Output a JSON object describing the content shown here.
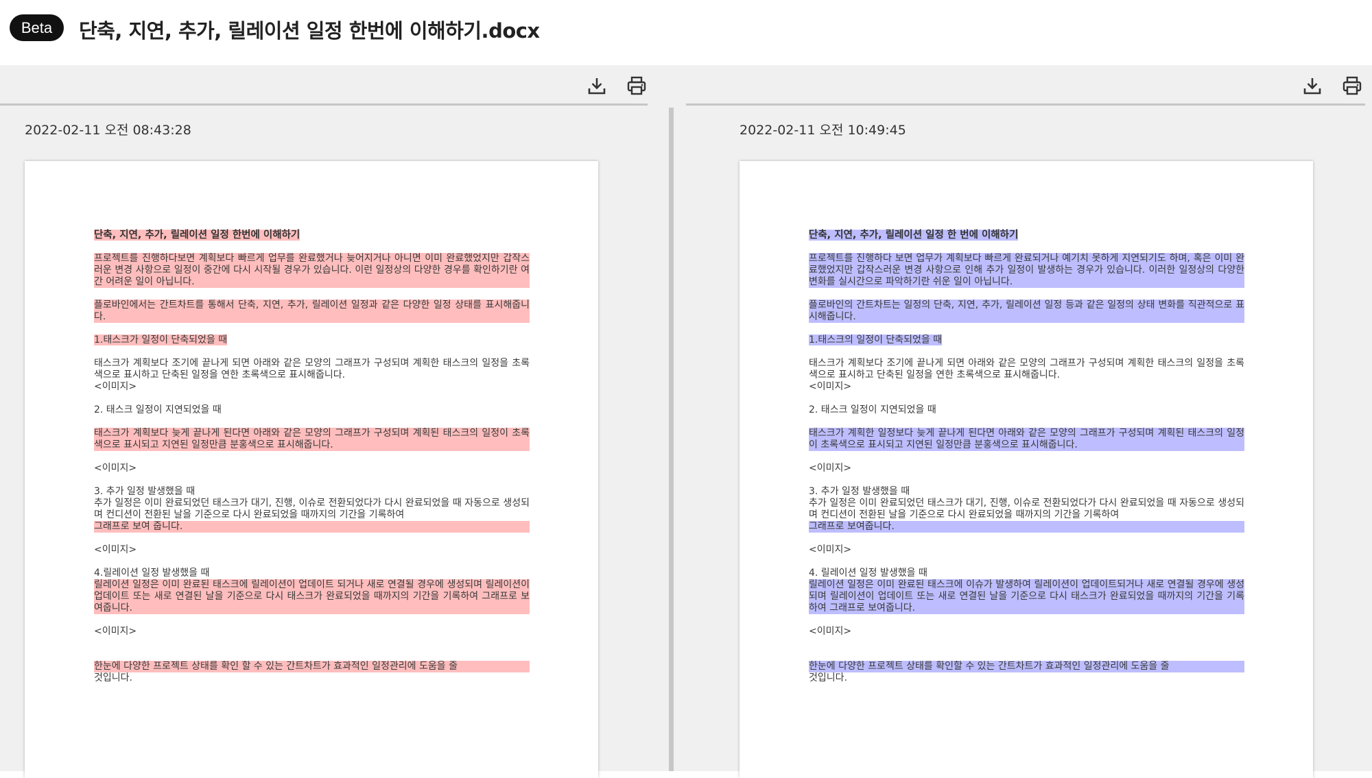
{
  "header": {
    "badge": "Beta",
    "title": "단축, 지연, 추가, 릴레이션 일정 한번에 이해하기.docx"
  },
  "colors": {
    "deleted_highlight": "#ffbdbd",
    "inserted_highlight": "#bdbdff",
    "badge_background": "#111111"
  },
  "toolbar_icons": {
    "download": "download-icon",
    "print": "print-icon"
  },
  "left": {
    "timestamp": "2022-02-11 오전 08:43:28",
    "title": "단축, 지연, 추가, 릴레이션 일정 한번에 이해하기",
    "p1": "프로젝트를 진행하다보면 계획보다 빠르게 업무를 완료했거나 늦어지거나 아니면 이미 완료했었지만 갑작스러운 변경 사항으로 일정이 중간에 다시 시작될 경우가 있습니다. 이런 일정상의 다양한 경우를 확인하기란 여간 어려운 일이 아닙니다.",
    "p2": "플로바인에서는 간트차트를 통해서 단축, 지연, 추가, 릴레이션 일정과 같은 다양한 일정 상태를 표시해줍니다.",
    "s1": "1.태스크가 일정이 단축되었을 때",
    "s1_body": "태스크가 계획보다 조기에 끝나게 되면 아래와 같은 모양의 그래프가 구성되며 계획한 태스크의 일정을 초록색으로 표시하고 단축된 일정을 연한 초록색으로 표시해줍니다.",
    "img1": "<이미지>",
    "s2": "2. 태스크 일정이 지연되었을 때",
    "s2_body": "태스크가 계획보다 늦게 끝나게 된다면 아래와 같은 모양의 그래프가 구성되며 계획된 태스크의 일정이 초록색으로 표시되고 지연된 일정만큼 분홍색으로 표시해줍니다.",
    "img2": "<이미지>",
    "s3": "3. 추가 일정 발생했을 때",
    "s3_body": "추가 일정은 이미 완료되었던 태스크가 대기, 진행, 이슈로 전환되었다가 다시 완료되었을 때 자동으로 생성되며 컨디션이 전환된 날을 기준으로 다시 완료되었을 때까지의 기간을 기록하여",
    "s3_tail": "그래프로 보여 줍니다.",
    "img3": "<이미지>",
    "s4": "4.릴레이션 일정 발생했을 때",
    "s4_body": "릴레이션 일정은 이미 완료된 태스크에 릴레이션이 업데이트 되거나 새로 연결될 경우에 생성되며 릴레이션이 업데이트 또는 새로 연결된 날을 기준으로 다시 태스크가 완료되었을 때까지의 기간을 기록하여 그래프로 보여줍니다.",
    "img4": "<이미지>",
    "closing": "한눈에 다양한 프로젝트 상태를 확인 할 수 있는 간트차트가 효과적인 일정관리에 도움을 줄",
    "closing_tail": "것입니다."
  },
  "right": {
    "timestamp": "2022-02-11 오전 10:49:45",
    "title": "단축, 지연, 추가, 릴레이션 일정 한 번에 이해하기",
    "p1": "프로젝트를 진행하다 보면 업무가 계획보다 빠르게 완료되거나 예기치 못하게 지연되기도 하며, 혹은 이미 완료했었지만 갑작스러운 변경 사항으로 인해 추가 일정이 발생하는 경우가 있습니다. 이러한 일정상의 다양한 변화를 실시간으로 파악하기란 쉬운 일이 아닙니다.",
    "p2": "플로바인의 간트차트는 일정의 단축, 지연, 추가, 릴레이션 일정 등과 같은 일정의 상태 변화를 직관적으로 표시해줍니다.",
    "s1": "1.태스크의 일정이 단축되었을 때",
    "s1_body": "태스크가 계획보다 조기에 끝나게 되면 아래와 같은 모양의 그래프가 구성되며 계획한 태스크의 일정을 초록색으로 표시하고 단축된 일정을 연한 초록색으로 표시해줍니다.",
    "img1": "<이미지>",
    "s2": "2. 태스크 일정이 지연되었을 때",
    "s2_body": "태스크가 계획한 일정보다 늦게 끝나게 된다면 아래와 같은 모양의 그래프가 구성되며 계획된 태스크의 일정이 초록색으로 표시되고 지연된 일정만큼 분홍색으로 표시해줍니다.",
    "img2": "<이미지>",
    "s3": "3. 추가 일정 발생했을 때",
    "s3_body": "추가 일정은 이미 완료되었던 태스크가 대기, 진행, 이슈로 전환되었다가 다시 완료되었을 때 자동으로 생성되며 컨디션이 전환된 날을 기준으로 다시 완료되었을 때까지의 기간을 기록하여",
    "s3_tail": "그래프로 보여줍니다.",
    "img3": "<이미지>",
    "s4": "4. 릴레이션 일정 발생했을 때",
    "s4_body": "릴레이션 일정은 이미 완료된 태스크에 이슈가 발생하여 릴레이션이 업데이트되거나 새로 연결될 경우에 생성되며 릴레이션이 업데이트 또는 새로 연결된 날을 기준으로 다시 태스크가 완료되었을 때까지의 기간을 기록하여 그래프로 보여줍니다.",
    "img4": "<이미지>",
    "closing": "한눈에 다양한 프로젝트 상태를 확인할 수 있는 간트차트가 효과적인 일정관리에 도움을 줄",
    "closing_tail": "것입니다."
  }
}
